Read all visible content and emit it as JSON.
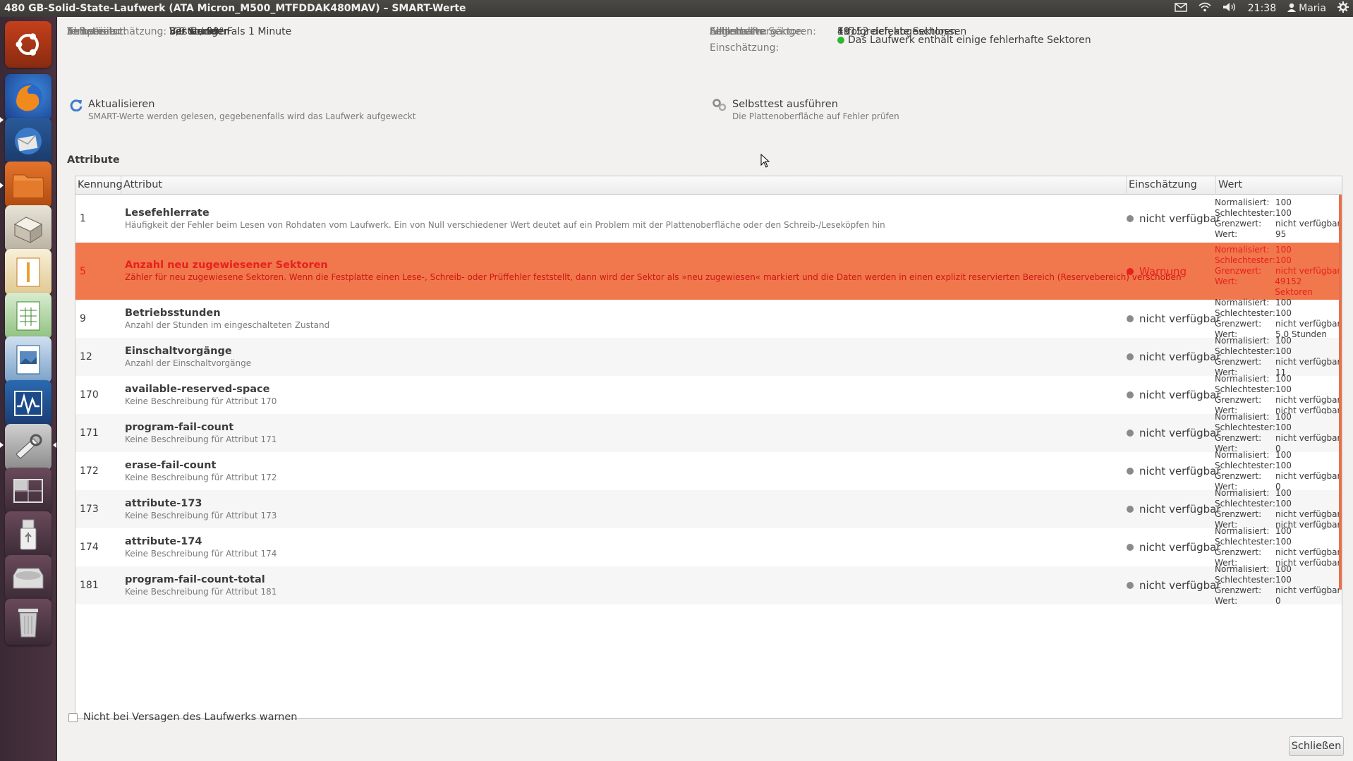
{
  "window": {
    "title": "480 GB-Solid-State-Laufwerk (ATA Micron_M500_MTFDDAK480MAV) – SMART-Werte"
  },
  "panel": {
    "time": "21:38",
    "user": "Maria"
  },
  "launcher": {
    "items": [
      "ubuntu-dash",
      "firefox",
      "thunderbird",
      "files",
      "software-center",
      "libreoffice-impress",
      "libreoffice-calc",
      "image-viewer",
      "system-monitor",
      "system-settings",
      "workspace-switcher",
      "usb-drive",
      "disk-drive",
      "trash"
    ]
  },
  "info_left": [
    {
      "label": "Aktualisiert:",
      "value": "Vor weniger als 1 Minute"
    },
    {
      "label": "In Betrieb:",
      "value": "5,0 Stunden"
    },
    {
      "label": "Temperatur:",
      "value": "32° C / 90° F"
    },
    {
      "label": "Selbsteinschätzung:",
      "value": "Bestanden"
    }
  ],
  "info_right": [
    {
      "label": "Selbsttests:",
      "value": "Erfolgreich abgeschlossen"
    },
    {
      "label": "Einschaltvorgänge:",
      "value": "11"
    },
    {
      "label": "Fehlerhafte Sektoren:",
      "value": "49152 defekte Sektoren"
    },
    {
      "label": "Allgemeine Einschätzung:",
      "value": "Das Laufwerk enthält einige fehlerhafte Sektoren"
    }
  ],
  "actions": {
    "refresh": {
      "title": "Aktualisieren",
      "desc": "SMART-Werte werden gelesen, gegebenenfalls wird das Laufwerk aufgeweckt"
    },
    "selftest": {
      "title": "Selbsttest ausführen",
      "desc": "Die Plattenoberfläche auf Fehler prüfen"
    }
  },
  "attributes_heading": "Attribute",
  "table": {
    "headers": {
      "id": "Kennung",
      "attr": "Attribut",
      "assessment": "Einschätzung",
      "value": "Wert"
    },
    "value_labels": {
      "normalized": "Normalisiert:",
      "worst": "Schlechtester:",
      "threshold": "Grenzwert:",
      "value": "Wert:"
    },
    "rows": [
      {
        "id": "1",
        "name": "Lesefehlerrate",
        "desc": "Häufigkeit der Fehler beim Lesen von Rohdaten vom Laufwerk. Ein von Null verschiedener Wert deutet auf ein Problem mit der Plattenoberfläche oder den Schreib-/Leseköpfen hin",
        "assessment": "nicht verfügbar",
        "normalized": "100",
        "worst": "100",
        "threshold": "nicht verfügbar",
        "value": "95"
      },
      {
        "id": "5",
        "name": "Anzahl neu zugewiesener Sektoren",
        "desc": "Zähler für neu zugewiesene Sektoren. Wenn die Festplatte einen Lese-, Schreib- oder Prüffehler feststellt, dann wird der Sektor als »neu zugewiesen« markiert und die Daten werden in einen explizit reservierten Bereich (Reservebereich) verschoben",
        "assessment": "Warnung",
        "normalized": "100",
        "worst": "100",
        "threshold": "nicht verfügbar",
        "value": "49152 Sektoren"
      },
      {
        "id": "9",
        "name": "Betriebsstunden",
        "desc": "Anzahl der Stunden im eingeschalteten Zustand",
        "assessment": "nicht verfügbar",
        "normalized": "100",
        "worst": "100",
        "threshold": "nicht verfügbar",
        "value": "5,0 Stunden"
      },
      {
        "id": "12",
        "name": "Einschaltvorgänge",
        "desc": "Anzahl der Einschaltvorgänge",
        "assessment": "nicht verfügbar",
        "normalized": "100",
        "worst": "100",
        "threshold": "nicht verfügbar",
        "value": "11"
      },
      {
        "id": "170",
        "name": "available-reserved-space",
        "desc": "Keine Beschreibung für Attribut 170",
        "assessment": "nicht verfügbar",
        "normalized": "100",
        "worst": "100",
        "threshold": "nicht verfügbar",
        "value": "nicht verfügbar"
      },
      {
        "id": "171",
        "name": "program-fail-count",
        "desc": "Keine Beschreibung für Attribut 171",
        "assessment": "nicht verfügbar",
        "normalized": "100",
        "worst": "100",
        "threshold": "nicht verfügbar",
        "value": "0"
      },
      {
        "id": "172",
        "name": "erase-fail-count",
        "desc": "Keine Beschreibung für Attribut 172",
        "assessment": "nicht verfügbar",
        "normalized": "100",
        "worst": "100",
        "threshold": "nicht verfügbar",
        "value": "0"
      },
      {
        "id": "173",
        "name": "attribute-173",
        "desc": "Keine Beschreibung für Attribut 173",
        "assessment": "nicht verfügbar",
        "normalized": "100",
        "worst": "100",
        "threshold": "nicht verfügbar",
        "value": "nicht verfügbar"
      },
      {
        "id": "174",
        "name": "attribute-174",
        "desc": "Keine Beschreibung für Attribut 174",
        "assessment": "nicht verfügbar",
        "normalized": "100",
        "worst": "100",
        "threshold": "nicht verfügbar",
        "value": "nicht verfügbar"
      },
      {
        "id": "181",
        "name": "program-fail-count-total",
        "desc": "Keine Beschreibung für Attribut 181",
        "assessment": "nicht verfügbar",
        "normalized": "100",
        "worst": "100",
        "threshold": "nicht verfügbar",
        "value": "0"
      }
    ]
  },
  "checkbox_label": "Nicht bei Versagen des Laufwerks warnen",
  "close_label": "Schließen",
  "colors": {
    "warning_row": "#f0784c",
    "warning_text": "#e8201f",
    "ok_dot": "#2fb82f",
    "neutral_dot": "#8a8a8a"
  }
}
